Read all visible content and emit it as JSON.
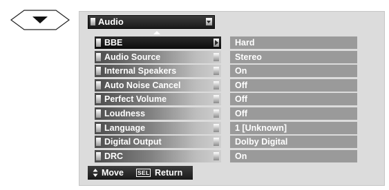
{
  "nav_button": {
    "icon": "down-arrow-icon"
  },
  "panel": {
    "title": "Audio",
    "scroll_indicator": "scroll-up-arrow-icon"
  },
  "menu": {
    "selected_index": 0,
    "items": [
      {
        "label": "BBE",
        "value": "Hard"
      },
      {
        "label": "Audio Source",
        "value": "Stereo"
      },
      {
        "label": "Internal Speakers",
        "value": "On"
      },
      {
        "label": "Auto Noise Cancel",
        "value": "Off"
      },
      {
        "label": "Perfect Volume",
        "value": "Off"
      },
      {
        "label": "Loudness",
        "value": "Off"
      },
      {
        "label": "Language",
        "value": "1 [Unknown]"
      },
      {
        "label": "Digital Output",
        "value": "Dolby Digital"
      },
      {
        "label": "DRC",
        "value": "On"
      }
    ]
  },
  "footer": {
    "move_label": "Move",
    "sel_key": "SEL",
    "return_label": "Return"
  },
  "colors": {
    "panel_background": "#dcdcdc",
    "value_background": "#9a9a9a",
    "selected_background": "#111111",
    "text": "#ffffff"
  }
}
